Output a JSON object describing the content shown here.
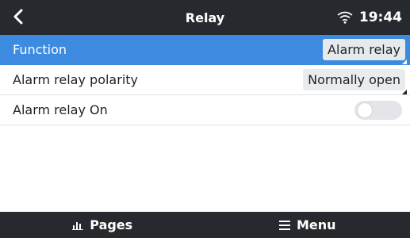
{
  "header": {
    "title": "Relay",
    "time": "19:44",
    "back_icon": "chevron-left-icon",
    "wifi_icon": "wifi-icon"
  },
  "rows": [
    {
      "label": "Function",
      "value": "Alarm relay",
      "selected": true
    },
    {
      "label": "Alarm relay polarity",
      "value": "Normally open",
      "selected": false
    },
    {
      "label": "Alarm relay On",
      "toggle_on": false,
      "selected": false
    }
  ],
  "footer": {
    "pages_label": "Pages",
    "menu_label": "Menu",
    "pages_icon": "bar-chart-icon",
    "menu_icon": "hamburger-menu-icon"
  },
  "colors": {
    "header_bg": "#26292e",
    "selected_row_bg": "#3c8be0",
    "value_box_bg": "#e9ebed",
    "toggle_off": "#e3e5e8"
  }
}
